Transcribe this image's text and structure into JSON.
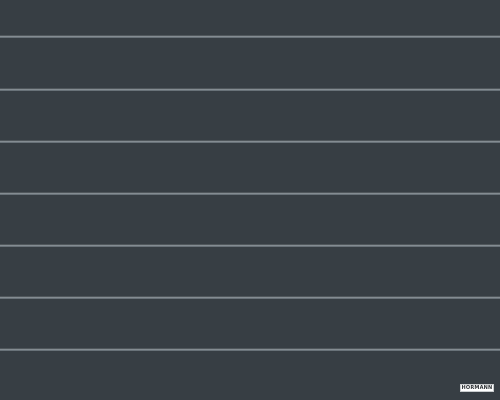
{
  "brand_label": {
    "text": "HÖRMANN"
  },
  "colors": {
    "door_surface": "#383f45",
    "groove_highlight": "#8e969c",
    "groove_shadow": "#2c3237",
    "label_background": "#ffffff",
    "label_text": "#2b2f33"
  }
}
